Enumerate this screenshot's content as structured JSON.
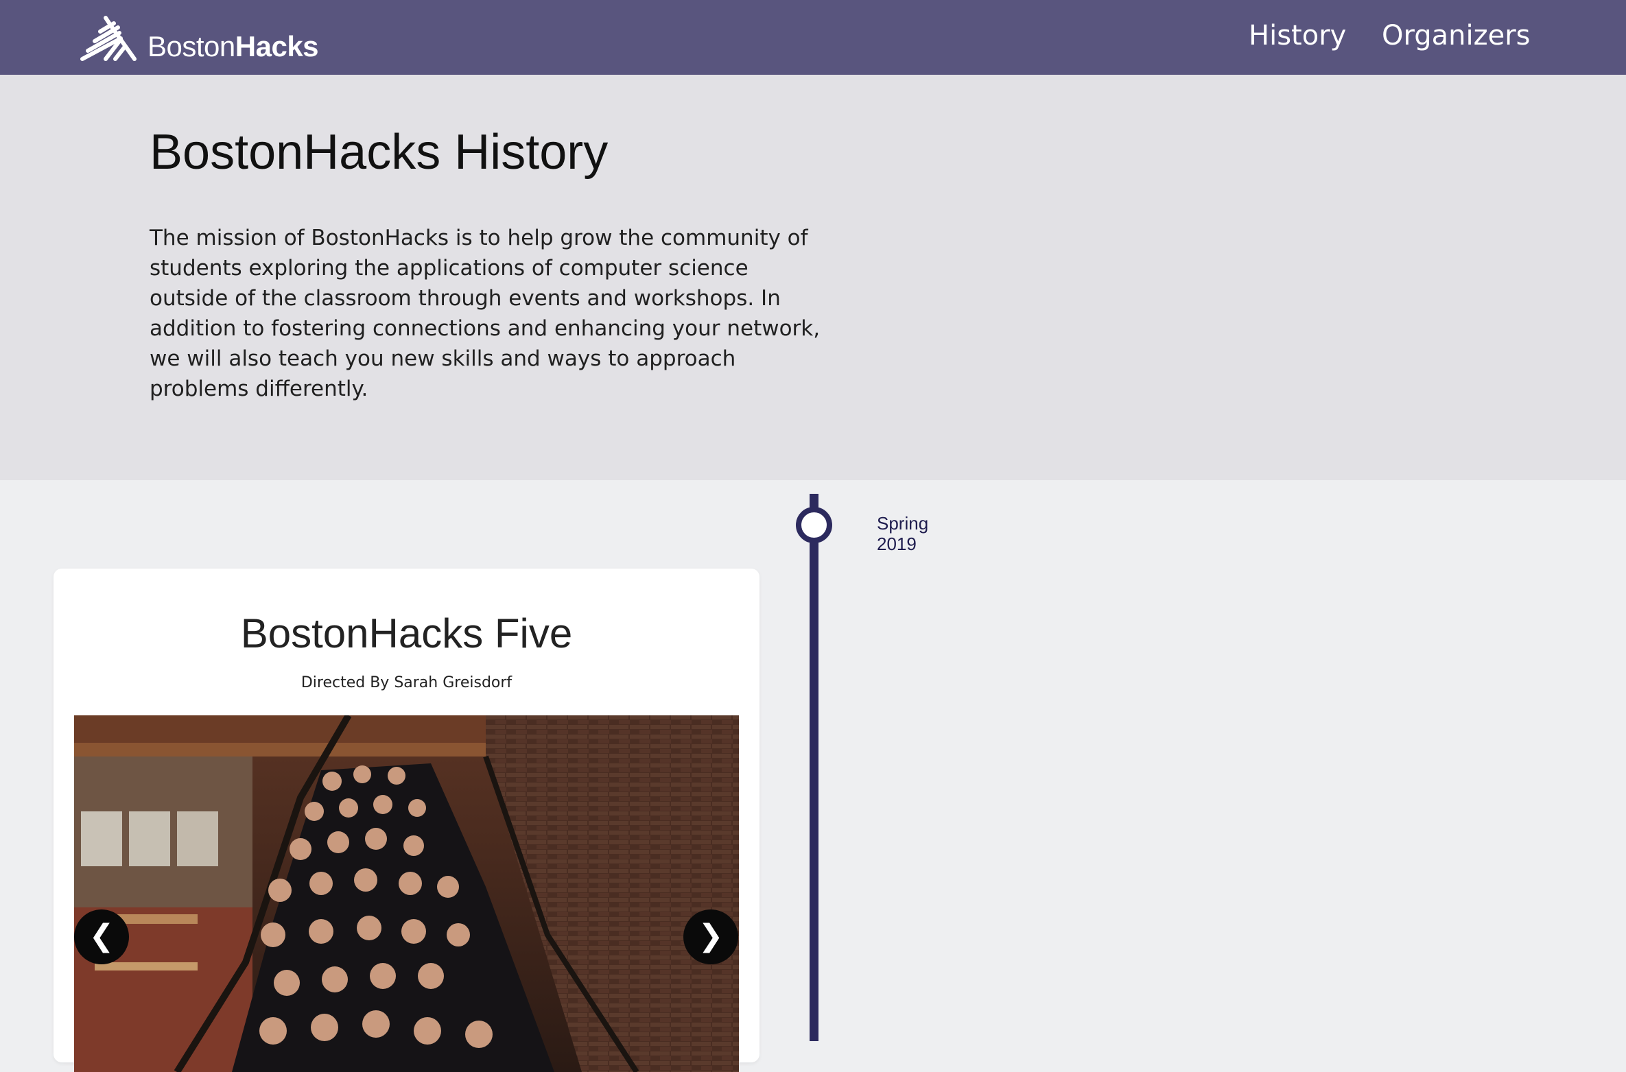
{
  "header": {
    "brand_light": "Boston",
    "brand_bold": "Hacks",
    "nav": [
      {
        "label": "History"
      },
      {
        "label": "Organizers"
      }
    ],
    "colors": {
      "bar": "#59557e",
      "text": "#ffffff"
    }
  },
  "hero": {
    "title": "BostonHacks History",
    "mission": "The mission of BostonHacks is to help grow the community of students exploring the applications of computer science outside of the classroom through events and workshops. In addition to fostering connections and enhancing your network, we will also teach you new skills and ways to approach problems differently."
  },
  "timeline": {
    "entries": [
      {
        "date": "Spring 2019",
        "title": "BostonHacks Five",
        "director": "Directed By Sarah Greisdorf",
        "photo": "group-photo-on-staircase",
        "carousel": {
          "prev_symbol": "❮",
          "next_symbol": "❯"
        }
      }
    ],
    "colors": {
      "line": "#2c2a5e",
      "node_fill": "#ffffff"
    }
  }
}
